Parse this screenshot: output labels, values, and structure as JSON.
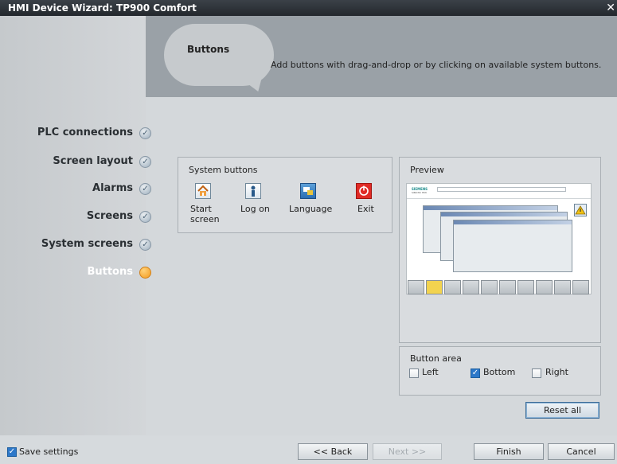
{
  "window": {
    "title": "HMI Device Wizard: TP900 Comfort",
    "close_glyph": "✕"
  },
  "header": {
    "title": "Buttons",
    "description": "Add buttons with drag-and-drop or by clicking on available system buttons."
  },
  "steps": [
    {
      "label": "PLC connections",
      "status": "done"
    },
    {
      "label": "Screen layout",
      "status": "done"
    },
    {
      "label": "Alarms",
      "status": "done"
    },
    {
      "label": "Screens",
      "status": "done"
    },
    {
      "label": "System screens",
      "status": "done"
    },
    {
      "label": "Buttons",
      "status": "current"
    }
  ],
  "system_buttons": {
    "title": "System buttons",
    "items": [
      {
        "label": "Start screen",
        "icon": "home-icon"
      },
      {
        "label": "Log on",
        "icon": "log-on-icon"
      },
      {
        "label": "Language",
        "icon": "language-icon"
      },
      {
        "label": "Exit",
        "icon": "exit-icon"
      }
    ]
  },
  "preview": {
    "title": "Preview",
    "siemens_text": "SIEMENS",
    "simatic_text": "SIMATIC HMI"
  },
  "button_area": {
    "title": "Button area",
    "options": [
      {
        "label": "Left",
        "checked": false
      },
      {
        "label": "Bottom",
        "checked": true
      },
      {
        "label": "Right",
        "checked": false
      }
    ]
  },
  "reset_all_label": "Reset all",
  "footer": {
    "save_settings_label": "Save settings",
    "save_settings_checked": true,
    "back_label": "<< Back",
    "next_label": "Next >>",
    "finish_label": "Finish",
    "cancel_label": "Cancel"
  },
  "colors": {
    "accent": "#2d78c9",
    "current_step": "#f39a1e"
  }
}
